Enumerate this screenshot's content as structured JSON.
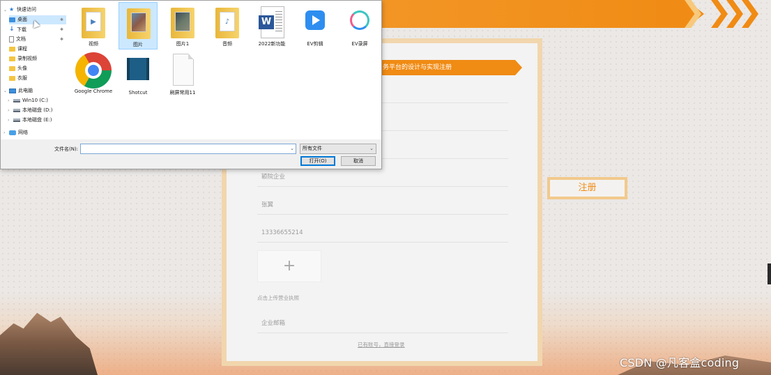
{
  "page": {
    "form_header": "务平台的设计与实现注册",
    "fields": [
      {
        "id": "company",
        "placeholder": "颖院企业"
      },
      {
        "id": "contact",
        "value": "张翼"
      },
      {
        "id": "phone",
        "value": "13336655214"
      },
      {
        "id": "email",
        "placeholder": "企业邮箱"
      }
    ],
    "upload_plus": "+",
    "upload_hint": "点击上传营业执照",
    "login_link": "已有账号，直接登录",
    "register_button": "注册",
    "watermark": "CSDN @凡客盒coding"
  },
  "dialog": {
    "nav": [
      {
        "label": "快速访问",
        "icon": "star-icon",
        "level": 0,
        "arrow": "⌄"
      },
      {
        "label": "桌面",
        "icon": "desktop-icon",
        "level": 1,
        "pinned": true,
        "selected": true
      },
      {
        "label": "下载",
        "icon": "download-icon",
        "level": 1,
        "pinned": true
      },
      {
        "label": "文档",
        "icon": "document-icon",
        "level": 1,
        "pinned": true
      },
      {
        "label": "课程",
        "icon": "folder-icon",
        "level": 1
      },
      {
        "label": "录制视频",
        "icon": "folder-icon",
        "level": 1
      },
      {
        "label": "头像",
        "icon": "folder-icon",
        "level": 1
      },
      {
        "label": "衣服",
        "icon": "folder-icon",
        "level": 1
      },
      {
        "label": "此电脑",
        "icon": "computer-icon",
        "level": 0,
        "arrow": "⌄"
      },
      {
        "label": "Win10 (C:)",
        "icon": "drive-icon",
        "level": 1,
        "arrow": "›"
      },
      {
        "label": "本地磁盘 (D:)",
        "icon": "drive-icon",
        "level": 1,
        "arrow": "›"
      },
      {
        "label": "本地磁盘 (E:)",
        "icon": "drive-icon",
        "level": 1,
        "arrow": "›"
      },
      {
        "label": "网络",
        "icon": "network-icon",
        "level": 0,
        "arrow": "›"
      }
    ],
    "files": [
      {
        "label": "视频",
        "kind": "folder-video"
      },
      {
        "label": "图片",
        "kind": "folder-photo",
        "selected": true
      },
      {
        "label": "图片1",
        "kind": "folder-photo2"
      },
      {
        "label": "音频",
        "kind": "folder-audio"
      },
      {
        "label": "2022新功能",
        "kind": "word"
      },
      {
        "label": "EV剪辑",
        "kind": "ev-editor"
      },
      {
        "label": "EV录屏",
        "kind": "ev-recorder"
      },
      {
        "label": "Google Chrome",
        "kind": "chrome"
      },
      {
        "label": "Shotcut",
        "kind": "shotcut"
      },
      {
        "label": "刷屏常用11",
        "kind": "blank-file"
      }
    ],
    "filename_label": "文件名(N):",
    "filename_value": "",
    "filetype": "所有文件",
    "open_button": "打开(O)",
    "cancel_button": "取消"
  }
}
